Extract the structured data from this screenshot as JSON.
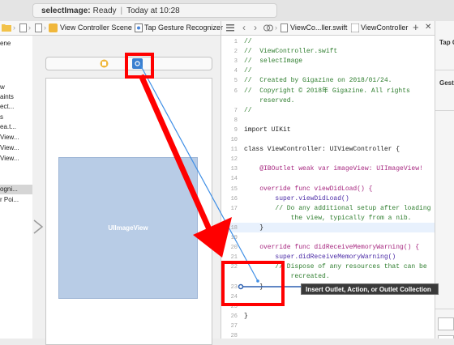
{
  "toolbar": {
    "status_target": "selectImage:",
    "status_state": "Ready",
    "status_separator": "|",
    "status_time": "Today at 10:28"
  },
  "jumpbar_left": {
    "scene": "View Controller Scene",
    "selected": "Tap Gesture Recognizer"
  },
  "jumpbar_right": {
    "file": "ViewCo...ller.swift",
    "symbol": "ViewController",
    "add_symbol": "+",
    "close_symbol": "✕"
  },
  "outline": {
    "items": [
      "ene",
      "w",
      "aints",
      "ect...",
      "s",
      "ea.t...",
      "View...",
      "View...",
      "View...",
      "ogni...",
      "r Poi..."
    ]
  },
  "canvas": {
    "image_view_label": "UIImageView"
  },
  "editor": {
    "lines": [
      {
        "n": "1",
        "t": "//",
        "k": "comment"
      },
      {
        "n": "2",
        "t": "//  ViewController.swift",
        "k": "comment"
      },
      {
        "n": "3",
        "t": "//  selectImage",
        "k": "comment"
      },
      {
        "n": "4",
        "t": "//",
        "k": "comment"
      },
      {
        "n": "5",
        "t": "//  Created by Gigazine on 2018/01/24.",
        "k": "comment"
      },
      {
        "n": "6",
        "t": "//  Copyright © 2018年 Gigazine. All rights",
        "k": "comment"
      },
      {
        "n": "",
        "t": "    reserved.",
        "k": "comment"
      },
      {
        "n": "7",
        "t": "//",
        "k": "comment"
      },
      {
        "n": "8",
        "t": "",
        "k": "plain"
      },
      {
        "n": "9",
        "t": "import UIKit",
        "k": "plain"
      },
      {
        "n": "10",
        "t": "",
        "k": "plain"
      },
      {
        "n": "11",
        "t": "class ViewController: UIViewController {",
        "k": "plain"
      },
      {
        "n": "12",
        "t": "",
        "k": "plain"
      },
      {
        "n": "13",
        "t": "    @IBOutlet weak var imageView: UIImageView!",
        "k": "kw"
      },
      {
        "n": "14",
        "t": "",
        "k": "plain"
      },
      {
        "n": "15",
        "t": "    override func viewDidLoad() {",
        "k": "kw"
      },
      {
        "n": "16",
        "t": "        super.viewDidLoad()",
        "k": "type"
      },
      {
        "n": "17",
        "t": "        // Do any additional setup after loading",
        "k": "comment"
      },
      {
        "n": "",
        "t": "            the view, typically from a nib.",
        "k": "comment"
      },
      {
        "n": "18",
        "t": "    }",
        "k": "plain"
      },
      {
        "n": "19",
        "t": "",
        "k": "plain"
      },
      {
        "n": "20",
        "t": "    override func didReceiveMemoryWarning() {",
        "k": "kw"
      },
      {
        "n": "21",
        "t": "        super.didReceiveMemoryWarning()",
        "k": "type"
      },
      {
        "n": "22",
        "t": "        // Dispose of any resources that can be",
        "k": "comment"
      },
      {
        "n": "",
        "t": "            recreated.",
        "k": "comment"
      },
      {
        "n": "23",
        "t": "    }",
        "k": "plain"
      },
      {
        "n": "24",
        "t": "",
        "k": "plain"
      },
      {
        "n": "25",
        "t": "",
        "k": "plain"
      },
      {
        "n": "26",
        "t": "}",
        "k": "plain"
      },
      {
        "n": "27",
        "t": "",
        "k": "plain"
      },
      {
        "n": "28",
        "t": "",
        "k": "plain"
      }
    ]
  },
  "inspector": {
    "label_top": "Tap G",
    "label_mid": "Gestu"
  },
  "tooltip": {
    "text": "Insert Outlet, Action, or Outlet Collection"
  },
  "colors": {
    "annotation_red": "#ff0000",
    "connection_blue": "#3f8fe6",
    "image_view_fill": "#b8cce6"
  }
}
